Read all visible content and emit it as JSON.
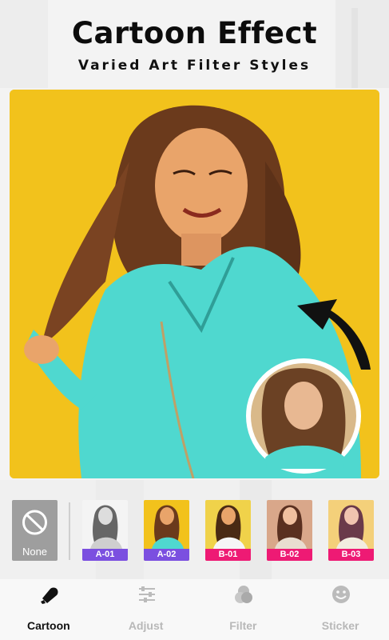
{
  "header": {
    "title": "Cartoon Effect",
    "subtitle": "Varied Art Filter Styles"
  },
  "filters": {
    "none_label": "None",
    "items": [
      {
        "label": "A-01",
        "color": "#7b4fe0"
      },
      {
        "label": "A-02",
        "color": "#7b4fe0"
      },
      {
        "label": "B-01",
        "color": "#ee1a74"
      },
      {
        "label": "B-02",
        "color": "#ee1a74"
      },
      {
        "label": "B-03",
        "color": "#ee1a74"
      }
    ]
  },
  "tabs": [
    {
      "label": "Cartoon",
      "active": true
    },
    {
      "label": "Adjust",
      "active": false
    },
    {
      "label": "Filter",
      "active": false
    },
    {
      "label": "Sticker",
      "active": false
    }
  ],
  "colors": {
    "photo_bg": "#f2c21c",
    "jacket": "#4fd8cf",
    "active_tab": "#111111",
    "inactive_tab": "#b8b8b8"
  }
}
